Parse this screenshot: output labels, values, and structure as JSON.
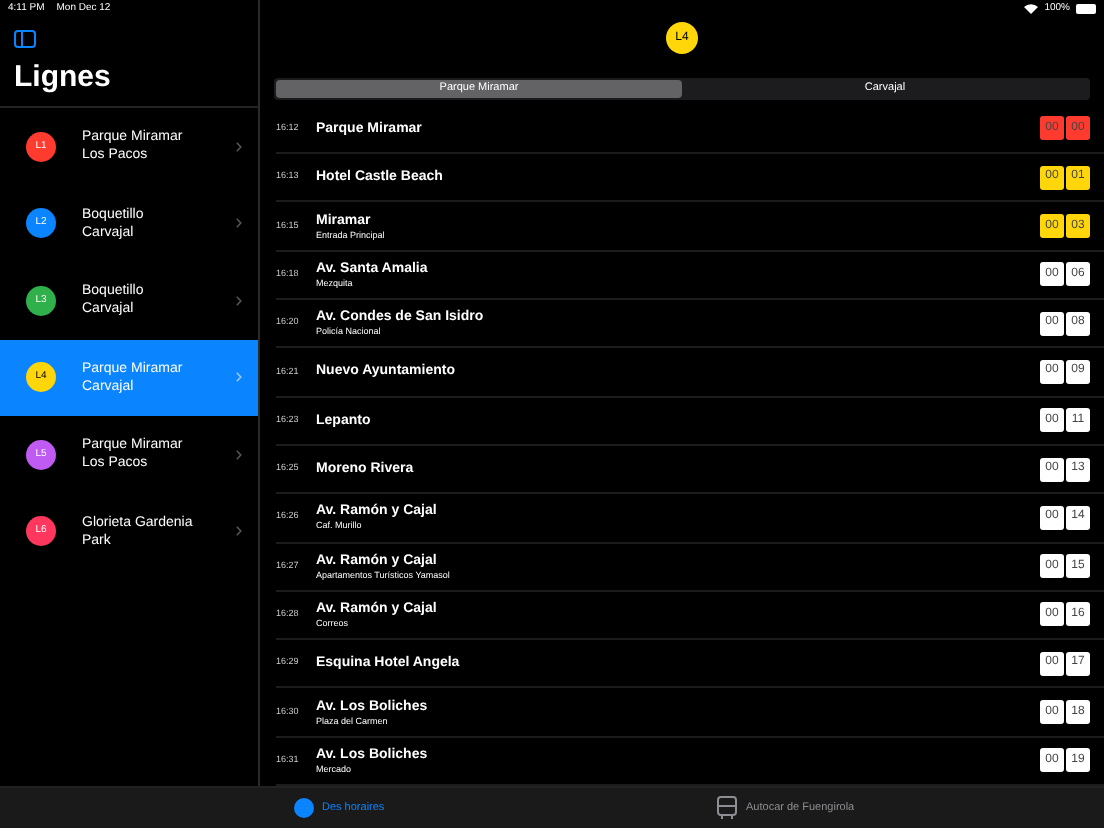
{
  "status_bar": {
    "time": "4:11 PM",
    "date": "Mon Dec 12",
    "battery": "100%"
  },
  "sidebar": {
    "title": "Lignes",
    "items": [
      {
        "badge": "L1",
        "color": "#ff3b30",
        "line1": "Parque Miramar",
        "line2": "Los Pacos",
        "selected": false
      },
      {
        "badge": "L2",
        "color": "#0a84ff",
        "line1": "Boquetillo",
        "line2": "Carvajal",
        "selected": false
      },
      {
        "badge": "L3",
        "color": "#30b04a",
        "line1": "Boquetillo",
        "line2": "Carvajal",
        "selected": false
      },
      {
        "badge": "L4",
        "color": "#ffd60a",
        "line1": "Parque Miramar",
        "line2": "Carvajal",
        "selected": true
      },
      {
        "badge": "L5",
        "color": "#bf5af2",
        "line1": "Parque Miramar",
        "line2": "Los Pacos",
        "selected": false
      },
      {
        "badge": "L6",
        "color": "#ff375f",
        "line1": "Glorieta Gardenia",
        "line2": "Park",
        "selected": false
      }
    ]
  },
  "detail": {
    "badge": "L4",
    "segments": [
      {
        "label": "Parque Miramar",
        "selected": true
      },
      {
        "label": "Carvajal",
        "selected": false
      }
    ],
    "stops": [
      {
        "time": "16:12",
        "name": "Parque Miramar",
        "hours": "00",
        "minutes": "00",
        "color": "#ff3b30"
      },
      {
        "time": "16:13",
        "name": "Hotel Castle Beach",
        "hours": "00",
        "minutes": "01",
        "color": "#ffd60a"
      },
      {
        "time": "16:15",
        "name": "Miramar",
        "sub": "Entrada Principal",
        "hours": "00",
        "minutes": "03",
        "color": "#ffd60a"
      },
      {
        "time": "16:18",
        "name": "Av. Santa Amalia",
        "sub": "Mezquita",
        "hours": "00",
        "minutes": "06",
        "color": "#ffffff"
      },
      {
        "time": "16:20",
        "name": "Av. Condes de San Isidro",
        "sub": "Policía Nacional",
        "hours": "00",
        "minutes": "08",
        "color": "#ffffff"
      },
      {
        "time": "16:21",
        "name": "Nuevo Ayuntamiento",
        "hours": "00",
        "minutes": "09",
        "color": "#ffffff"
      },
      {
        "time": "16:23",
        "name": "Lepanto",
        "hours": "00",
        "minutes": "11",
        "color": "#ffffff"
      },
      {
        "time": "16:25",
        "name": "Moreno Rivera",
        "hours": "00",
        "minutes": "13",
        "color": "#ffffff"
      },
      {
        "time": "16:26",
        "name": "Av. Ramón y Cajal",
        "sub": "Caf. Murillo",
        "hours": "00",
        "minutes": "14",
        "color": "#ffffff"
      },
      {
        "time": "16:27",
        "name": "Av. Ramón y Cajal",
        "sub": "Apartamentos Turísticos Yamasol",
        "hours": "00",
        "minutes": "15",
        "color": "#ffffff"
      },
      {
        "time": "16:28",
        "name": "Av. Ramón y Cajal",
        "sub": "Correos",
        "hours": "00",
        "minutes": "16",
        "color": "#ffffff"
      },
      {
        "time": "16:29",
        "name": "Esquina Hotel Angela",
        "hours": "00",
        "minutes": "17",
        "color": "#ffffff"
      },
      {
        "time": "16:30",
        "name": "Av. Los Boliches",
        "sub": "Plaza del Carmen",
        "hours": "00",
        "minutes": "18",
        "color": "#ffffff"
      },
      {
        "time": "16:31",
        "name": "Av. Los Boliches",
        "sub": "Mercado",
        "hours": "00",
        "minutes": "19",
        "color": "#ffffff"
      }
    ]
  },
  "tab_bar": [
    {
      "label": "Des horaires",
      "kind": "circle",
      "selected": true
    },
    {
      "label": "Autocar de Fuengirola",
      "kind": "bus",
      "selected": false
    }
  ]
}
